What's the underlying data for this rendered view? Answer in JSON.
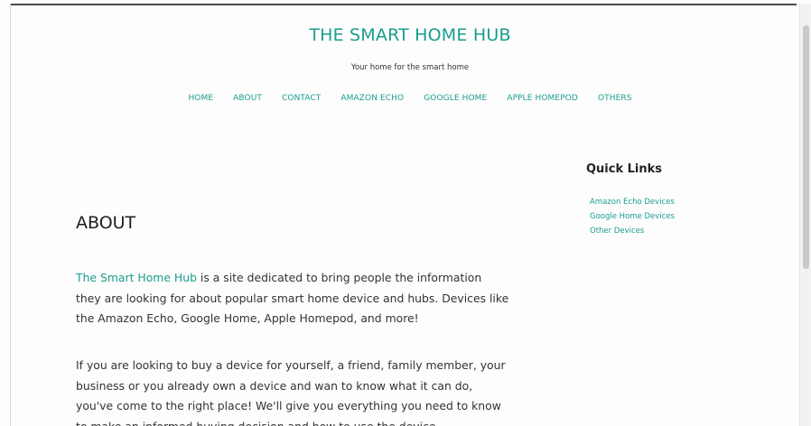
{
  "header": {
    "site_title": "THE SMART HOME HUB",
    "tagline": "Your home for the smart home"
  },
  "nav": {
    "items": [
      {
        "label": "HOME"
      },
      {
        "label": "ABOUT"
      },
      {
        "label": "CONTACT"
      },
      {
        "label": "AMAZON ECHO"
      },
      {
        "label": "GOOGLE HOME"
      },
      {
        "label": "APPLE HOMEPOD"
      },
      {
        "label": "OTHERS"
      }
    ]
  },
  "main": {
    "heading": "ABOUT",
    "paragraph1": {
      "link_text": "The Smart Home Hub",
      "text": " is a site dedicated to bring people the information they are looking for about popular smart home device and hubs. Devices like the Amazon Echo, Google Home, Apple Homepod, and more!"
    },
    "paragraph2": "If you are looking to buy a device for yourself, a friend, family member, your business or you already own a device and wan to know what it can do, you've come to the right place! We'll give you everything you need to know to make an informed buying decision and how to use the device."
  },
  "sidebar": {
    "title": "Quick Links",
    "links": [
      {
        "label": "Amazon Echo Devices"
      },
      {
        "label": "Google Home Devices"
      },
      {
        "label": "Other Devices"
      }
    ]
  },
  "colors": {
    "accent": "#1a9d8d",
    "text": "#333333"
  }
}
